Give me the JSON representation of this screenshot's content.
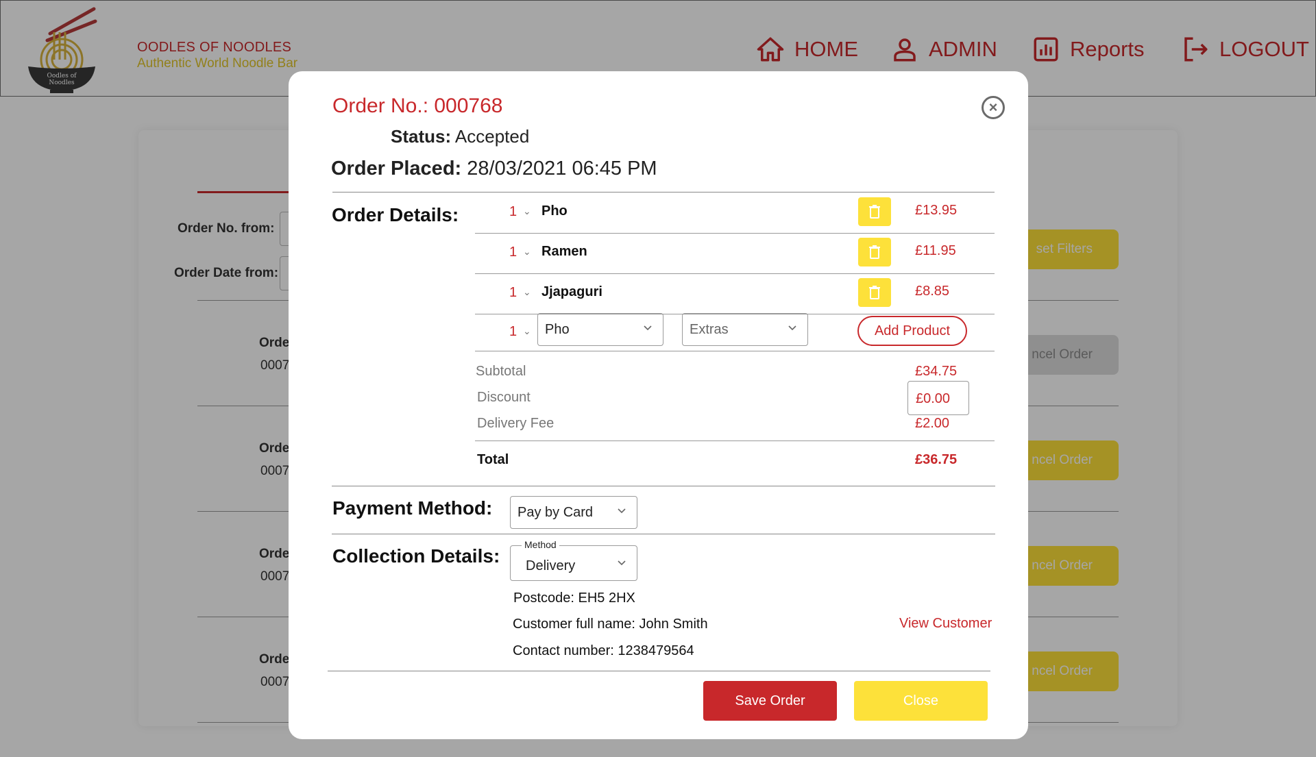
{
  "header": {
    "logo_text": [
      "Oodles of",
      "Noodles"
    ],
    "brand_name": "OODLES OF NOODLES",
    "brand_tagline": "Authentic World Noodle Bar",
    "nav": [
      {
        "label": "HOME",
        "icon": "home-icon"
      },
      {
        "label": "ADMIN",
        "icon": "user-icon"
      },
      {
        "label": "Reports",
        "icon": "chart-icon"
      },
      {
        "label": "LOGOUT",
        "icon": "logout-icon"
      }
    ]
  },
  "background": {
    "filters": {
      "order_no_from": "Order No. from:",
      "order_date_from": "Order Date from:"
    },
    "reset_button": "set Filters",
    "orders": [
      {
        "label": "Orde",
        "number": "0007",
        "button": "ncel Order"
      },
      {
        "label": "Orde",
        "number": "0007",
        "button": "ncel Order"
      },
      {
        "label": "Orde",
        "number": "0007",
        "button": "ncel Order"
      },
      {
        "label": "Orde",
        "number": "0007",
        "button": "ncel Order"
      }
    ]
  },
  "modal": {
    "order_no": "Order No.: 000768",
    "status_label": "Status:",
    "status_value": "Accepted",
    "placed_label": "Order Placed:",
    "placed_value": "28/03/2021 06:45 PM",
    "order_details_title": "Order Details:",
    "items": [
      {
        "qty": "1",
        "name": "Pho",
        "price": "£13.95"
      },
      {
        "qty": "1",
        "name": "Ramen",
        "price": "£11.95"
      },
      {
        "qty": "1",
        "name": "Jjapaguri",
        "price": "£8.85"
      }
    ],
    "new_item": {
      "qty": "1",
      "product": "Pho",
      "extras_placeholder": "Extras",
      "add_button": "Add Product"
    },
    "summary": {
      "subtotal_label": "Subtotal",
      "subtotal": "£34.75",
      "discount_label": "Discount",
      "discount": "£0.00",
      "delivery_label": "Delivery Fee",
      "delivery": "£2.00",
      "total_label": "Total",
      "total": "£36.75"
    },
    "payment_title": "Payment Method:",
    "payment_value": "Pay by Card",
    "collection_title": "Collection Details:",
    "method_legend": "Method",
    "method_value": "Delivery",
    "postcode": "Postcode: EH5 2HX",
    "customer_name": "Customer full name: John Smith",
    "contact": "Contact number: 1238479564",
    "view_customer": "View Customer",
    "save_button": "Save Order",
    "close_button": "Close"
  },
  "colors": {
    "brand_red": "#c8282b",
    "brand_yellow": "#fde13a",
    "overlay": "rgba(0,0,0,0.35)"
  }
}
